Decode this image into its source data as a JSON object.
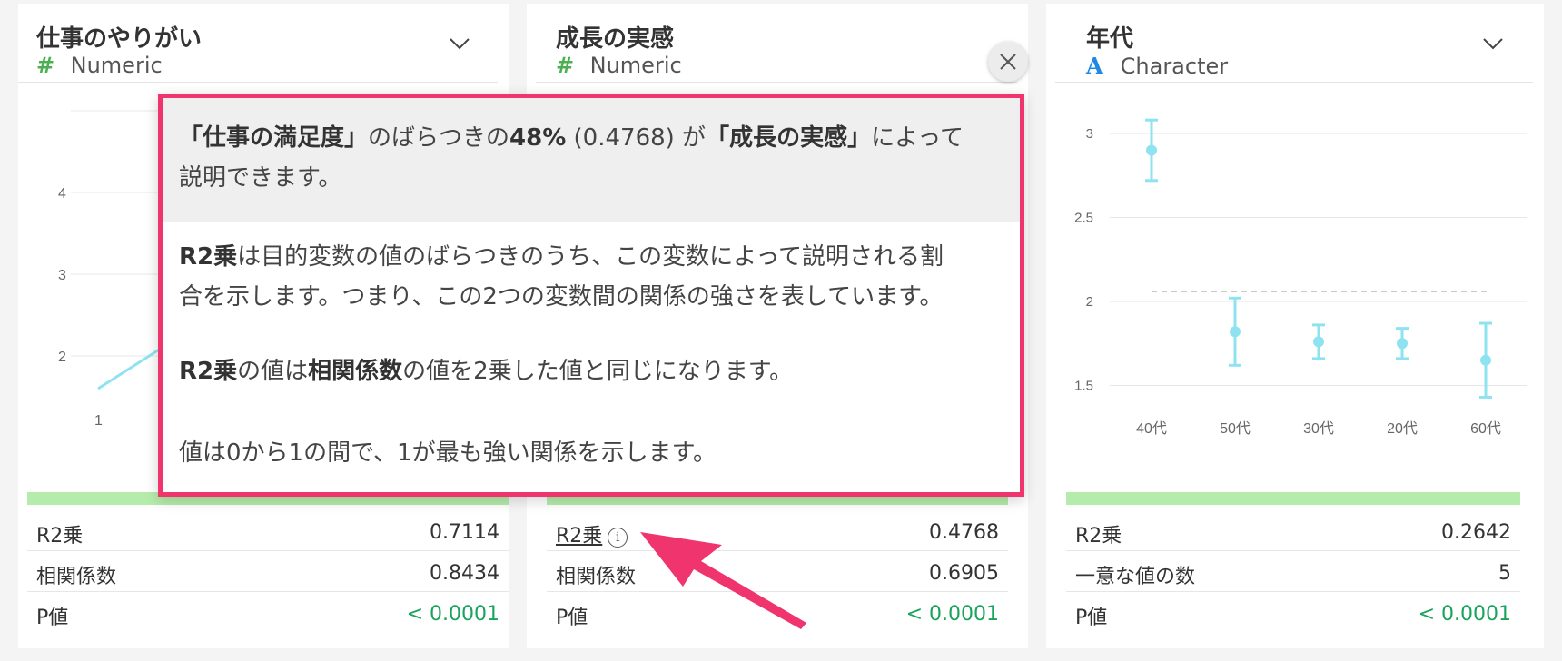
{
  "cards": [
    {
      "title": "仕事のやりがい",
      "type_icon": "#",
      "type_label": "Numeric",
      "stats": [
        {
          "label": "R2乗",
          "value": "0.7114"
        },
        {
          "label": "相関係数",
          "value": "0.8434"
        },
        {
          "label": "P値",
          "value": "< 0.0001"
        }
      ],
      "y_ticks": [
        "4",
        "3",
        "2"
      ],
      "x_ticks": [
        "1"
      ]
    },
    {
      "title": "成長の実感",
      "type_icon": "#",
      "type_label": "Numeric",
      "stats": [
        {
          "label": "R2乗",
          "value": "0.4768"
        },
        {
          "label": "相関係数",
          "value": "0.6905"
        },
        {
          "label": "P値",
          "value": "< 0.0001"
        }
      ]
    },
    {
      "title": "年代",
      "type_icon": "A",
      "type_label": "Character",
      "stats": [
        {
          "label": "R2乗",
          "value": "0.2642"
        },
        {
          "label": "一意な値の数",
          "value": "5"
        },
        {
          "label": "P値",
          "value": "< 0.0001"
        }
      ]
    }
  ],
  "popover": {
    "head": {
      "p1": "「仕事の満足度」",
      "p2": "のばらつきの",
      "p3": "48%",
      "p4": " (0.4768) が",
      "p5": "「成長の実感」",
      "p6": "によって",
      "p7": "説明できます。"
    },
    "para1": {
      "b": "R2乗",
      "t1": "は目的変数の値のばらつきのうち、この変数によって説明される割",
      "t2": "合を示します。つまり、この2つの変数間の関係の強さを表しています。"
    },
    "para2": {
      "b1": "R2乗",
      "t1": "の値は",
      "b2": "相関係数",
      "t2": "の値を2乗した値と同じになります。"
    },
    "para3": "値は0から1の間で、1が最も強い関係を示します。"
  },
  "colors": {
    "accent_pink": "#f0346d",
    "bar_green": "#b5ecab",
    "pvalue_green": "#1aa35c",
    "errorbar_cyan": "#8fe3f0",
    "numeric_icon": "#4caf50",
    "character_icon": "#1e88e5"
  },
  "chart_data": {
    "type": "scatter",
    "title": "",
    "xlabel": "",
    "ylabel": "",
    "categories": [
      "40代",
      "50代",
      "30代",
      "20代",
      "60代"
    ],
    "series": [
      {
        "mean": [
          2.9,
          1.82,
          1.76,
          1.75,
          1.65
        ],
        "lower": [
          2.72,
          1.62,
          1.66,
          1.66,
          1.43
        ],
        "upper": [
          3.08,
          2.02,
          1.86,
          1.84,
          1.87
        ]
      }
    ],
    "reference_line": 2.06,
    "y_ticks": [
      3,
      2.5,
      2,
      1.5
    ],
    "ylim": [
      1.3,
      3.15
    ],
    "grid": true
  }
}
